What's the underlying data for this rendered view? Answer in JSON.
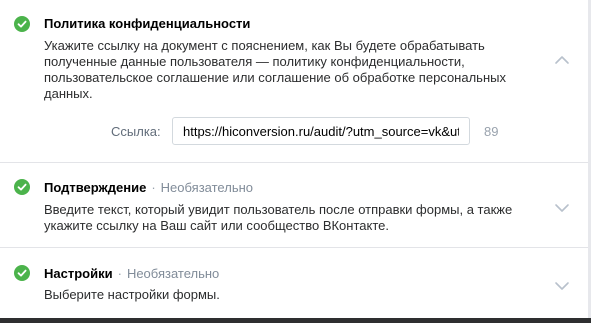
{
  "sections": [
    {
      "title": "Политика конфиденциальности",
      "optional": "",
      "description": "Укажите ссылку на документ с пояснением, как Вы будете обрабатывать полученные данные пользователя — политику конфиденциальности, пользовательское соглашение или соглашение об обработке персональных данных.",
      "link_label": "Ссылка:",
      "link_value": "https://hiconversion.ru/audit/?utm_source=vk&utm",
      "link_counter": "89",
      "expanded": true
    },
    {
      "title": "Подтверждение",
      "separator": "·",
      "optional": "Необязательно",
      "description": "Введите текст, который увидит пользователь после отправки формы, а также укажите ссылку на Ваш сайт или сообщество ВКонтакте.",
      "expanded": false
    },
    {
      "title": "Настройки",
      "separator": "·",
      "optional": "Необязательно",
      "description": "Выберите настройки формы.",
      "expanded": false
    }
  ],
  "colors": {
    "check": "#4bb34b",
    "chevron": "#b8c1cc",
    "divider": "#e3e4e8"
  }
}
